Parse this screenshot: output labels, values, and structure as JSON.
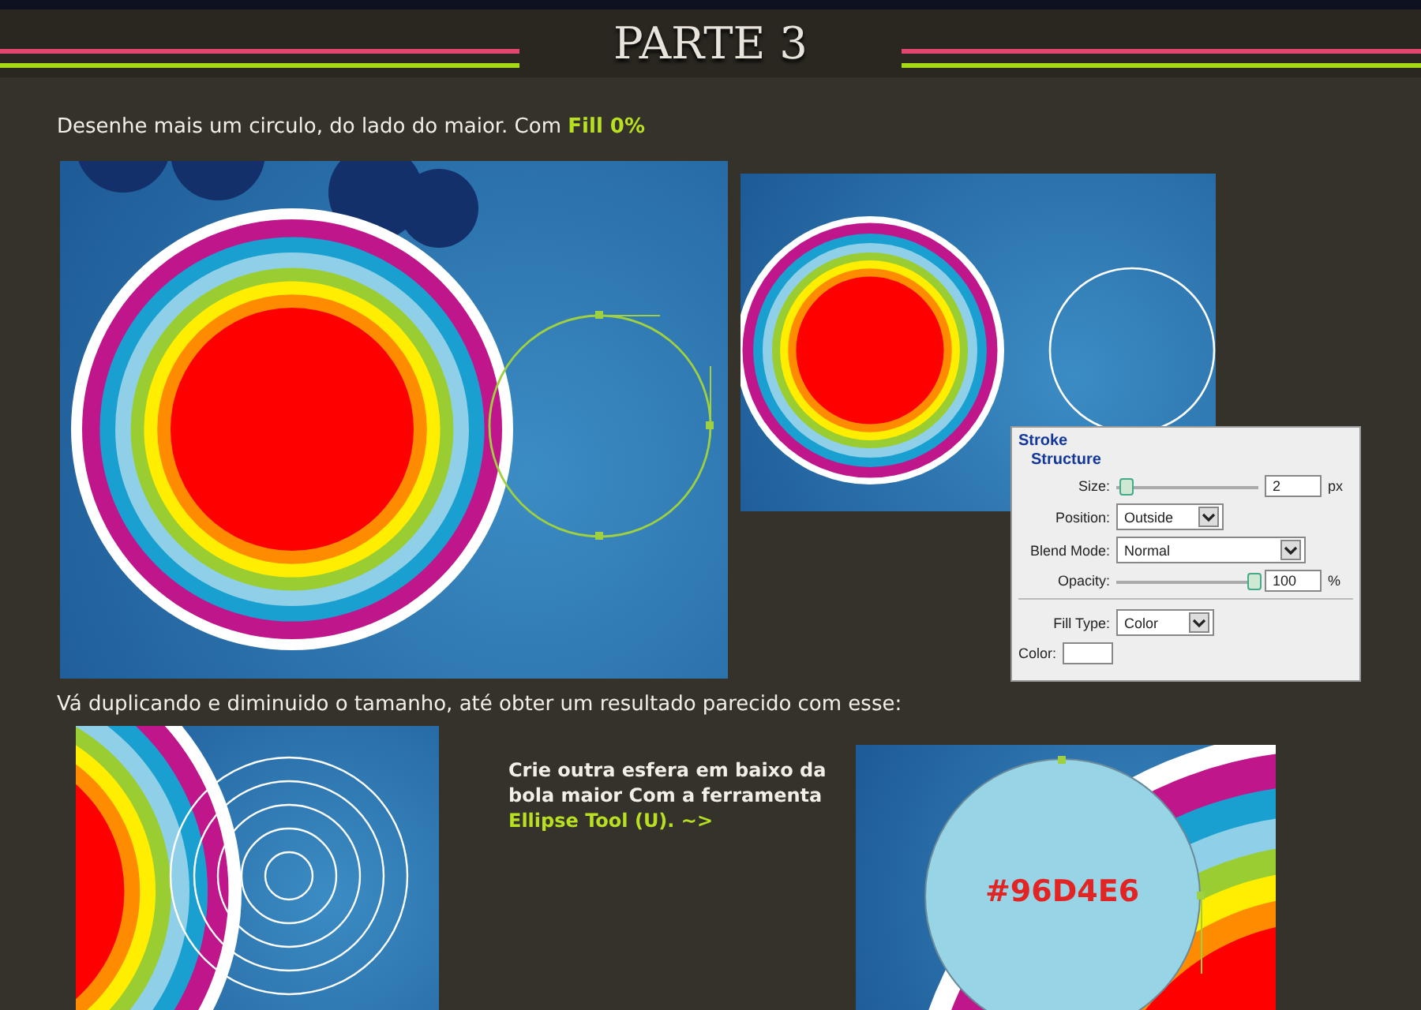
{
  "header": {
    "title": "PARTE 3"
  },
  "intro": {
    "text": "Desenhe mais um circulo, do lado do maior. Com",
    "highlight": "Fill 0%"
  },
  "stroke_panel": {
    "title": "Stroke",
    "section": "Structure",
    "size": {
      "label": "Size:",
      "level": 0.02,
      "value": "2",
      "unit": "px"
    },
    "position": {
      "label": "Position:",
      "value": "Outside"
    },
    "blend_mode": {
      "label": "Blend Mode:",
      "value": "Normal"
    },
    "opacity": {
      "label": "Opacity:",
      "level": 1,
      "value": "100",
      "unit": "%"
    },
    "fill_type": {
      "label": "Fill Type:",
      "value": "Color"
    },
    "color": {
      "label": "Color:"
    }
  },
  "step2": {
    "text": "Vá duplicando e diminuido o tamanho, até obter um resultado parecido com esse:"
  },
  "step3": {
    "text": "Crie outra esfera em baixo da bola maior Com a ferramenta",
    "highlight": "Ellipse Tool (U).",
    "arrow": "~>"
  },
  "swatch": {
    "label": "#96D4E6"
  }
}
